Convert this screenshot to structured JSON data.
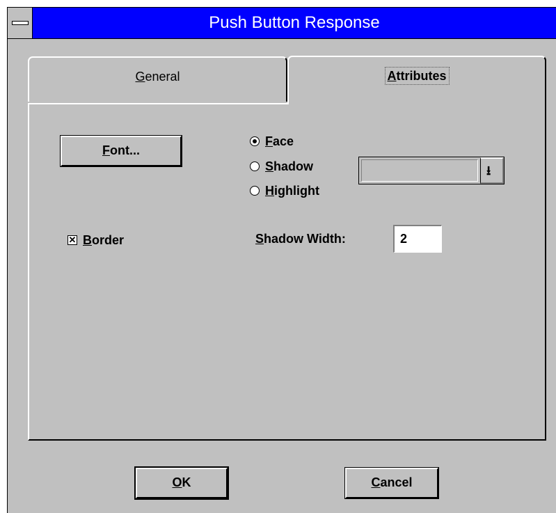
{
  "window": {
    "title": "Push Button Response"
  },
  "tabs": {
    "general": {
      "label_prefix": "",
      "label_hotkey": "G",
      "label_rest": "eneral"
    },
    "attributes": {
      "label_prefix": "",
      "label_hotkey": "A",
      "label_rest": "ttributes"
    }
  },
  "font_button": {
    "hotkey": "F",
    "rest": "ont..."
  },
  "color_target": {
    "options": [
      {
        "hotkey": "F",
        "rest": "ace",
        "selected": true
      },
      {
        "hotkey": "S",
        "rest": "hadow",
        "selected": false
      },
      {
        "hotkey": "H",
        "rest": "ighlight",
        "selected": false
      }
    ]
  },
  "color_combo": {
    "value": ""
  },
  "border": {
    "checked": true,
    "check_glyph": "✕",
    "hotkey": "B",
    "rest": "order"
  },
  "shadow_width": {
    "hotkey": "S",
    "rest": "hadow Width:",
    "value": "2"
  },
  "buttons": {
    "ok": {
      "hotkey": "O",
      "rest": "K"
    },
    "cancel": {
      "hotkey": "C",
      "rest": "ancel"
    }
  },
  "icons": {
    "system_menu": "system-menu-icon",
    "dropdown": "down-arrow-icon",
    "dropdown_glyph": "⭳"
  },
  "colors": {
    "titlebar": "#0000ff",
    "face": "#c0c0c0"
  }
}
